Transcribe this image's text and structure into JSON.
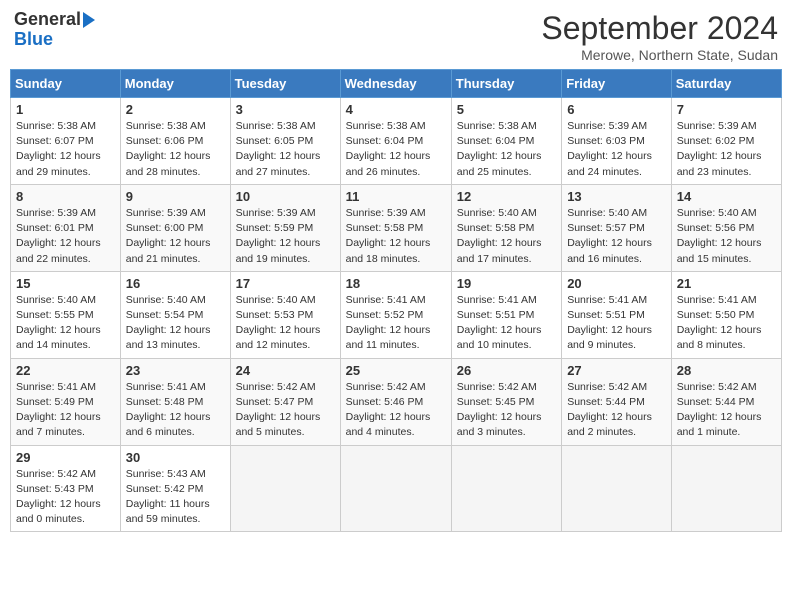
{
  "logo": {
    "line1": "General",
    "line2": "Blue"
  },
  "title": "September 2024",
  "subtitle": "Merowe, Northern State, Sudan",
  "headers": [
    "Sunday",
    "Monday",
    "Tuesday",
    "Wednesday",
    "Thursday",
    "Friday",
    "Saturday"
  ],
  "weeks": [
    [
      {
        "day": "1",
        "info": "Sunrise: 5:38 AM\nSunset: 6:07 PM\nDaylight: 12 hours\nand 29 minutes."
      },
      {
        "day": "2",
        "info": "Sunrise: 5:38 AM\nSunset: 6:06 PM\nDaylight: 12 hours\nand 28 minutes."
      },
      {
        "day": "3",
        "info": "Sunrise: 5:38 AM\nSunset: 6:05 PM\nDaylight: 12 hours\nand 27 minutes."
      },
      {
        "day": "4",
        "info": "Sunrise: 5:38 AM\nSunset: 6:04 PM\nDaylight: 12 hours\nand 26 minutes."
      },
      {
        "day": "5",
        "info": "Sunrise: 5:38 AM\nSunset: 6:04 PM\nDaylight: 12 hours\nand 25 minutes."
      },
      {
        "day": "6",
        "info": "Sunrise: 5:39 AM\nSunset: 6:03 PM\nDaylight: 12 hours\nand 24 minutes."
      },
      {
        "day": "7",
        "info": "Sunrise: 5:39 AM\nSunset: 6:02 PM\nDaylight: 12 hours\nand 23 minutes."
      }
    ],
    [
      {
        "day": "8",
        "info": "Sunrise: 5:39 AM\nSunset: 6:01 PM\nDaylight: 12 hours\nand 22 minutes."
      },
      {
        "day": "9",
        "info": "Sunrise: 5:39 AM\nSunset: 6:00 PM\nDaylight: 12 hours\nand 21 minutes."
      },
      {
        "day": "10",
        "info": "Sunrise: 5:39 AM\nSunset: 5:59 PM\nDaylight: 12 hours\nand 19 minutes."
      },
      {
        "day": "11",
        "info": "Sunrise: 5:39 AM\nSunset: 5:58 PM\nDaylight: 12 hours\nand 18 minutes."
      },
      {
        "day": "12",
        "info": "Sunrise: 5:40 AM\nSunset: 5:58 PM\nDaylight: 12 hours\nand 17 minutes."
      },
      {
        "day": "13",
        "info": "Sunrise: 5:40 AM\nSunset: 5:57 PM\nDaylight: 12 hours\nand 16 minutes."
      },
      {
        "day": "14",
        "info": "Sunrise: 5:40 AM\nSunset: 5:56 PM\nDaylight: 12 hours\nand 15 minutes."
      }
    ],
    [
      {
        "day": "15",
        "info": "Sunrise: 5:40 AM\nSunset: 5:55 PM\nDaylight: 12 hours\nand 14 minutes."
      },
      {
        "day": "16",
        "info": "Sunrise: 5:40 AM\nSunset: 5:54 PM\nDaylight: 12 hours\nand 13 minutes."
      },
      {
        "day": "17",
        "info": "Sunrise: 5:40 AM\nSunset: 5:53 PM\nDaylight: 12 hours\nand 12 minutes."
      },
      {
        "day": "18",
        "info": "Sunrise: 5:41 AM\nSunset: 5:52 PM\nDaylight: 12 hours\nand 11 minutes."
      },
      {
        "day": "19",
        "info": "Sunrise: 5:41 AM\nSunset: 5:51 PM\nDaylight: 12 hours\nand 10 minutes."
      },
      {
        "day": "20",
        "info": "Sunrise: 5:41 AM\nSunset: 5:51 PM\nDaylight: 12 hours\nand 9 minutes."
      },
      {
        "day": "21",
        "info": "Sunrise: 5:41 AM\nSunset: 5:50 PM\nDaylight: 12 hours\nand 8 minutes."
      }
    ],
    [
      {
        "day": "22",
        "info": "Sunrise: 5:41 AM\nSunset: 5:49 PM\nDaylight: 12 hours\nand 7 minutes."
      },
      {
        "day": "23",
        "info": "Sunrise: 5:41 AM\nSunset: 5:48 PM\nDaylight: 12 hours\nand 6 minutes."
      },
      {
        "day": "24",
        "info": "Sunrise: 5:42 AM\nSunset: 5:47 PM\nDaylight: 12 hours\nand 5 minutes."
      },
      {
        "day": "25",
        "info": "Sunrise: 5:42 AM\nSunset: 5:46 PM\nDaylight: 12 hours\nand 4 minutes."
      },
      {
        "day": "26",
        "info": "Sunrise: 5:42 AM\nSunset: 5:45 PM\nDaylight: 12 hours\nand 3 minutes."
      },
      {
        "day": "27",
        "info": "Sunrise: 5:42 AM\nSunset: 5:44 PM\nDaylight: 12 hours\nand 2 minutes."
      },
      {
        "day": "28",
        "info": "Sunrise: 5:42 AM\nSunset: 5:44 PM\nDaylight: 12 hours\nand 1 minute."
      }
    ],
    [
      {
        "day": "29",
        "info": "Sunrise: 5:42 AM\nSunset: 5:43 PM\nDaylight: 12 hours\nand 0 minutes."
      },
      {
        "day": "30",
        "info": "Sunrise: 5:43 AM\nSunset: 5:42 PM\nDaylight: 11 hours\nand 59 minutes."
      },
      {
        "day": "",
        "info": ""
      },
      {
        "day": "",
        "info": ""
      },
      {
        "day": "",
        "info": ""
      },
      {
        "day": "",
        "info": ""
      },
      {
        "day": "",
        "info": ""
      }
    ]
  ]
}
